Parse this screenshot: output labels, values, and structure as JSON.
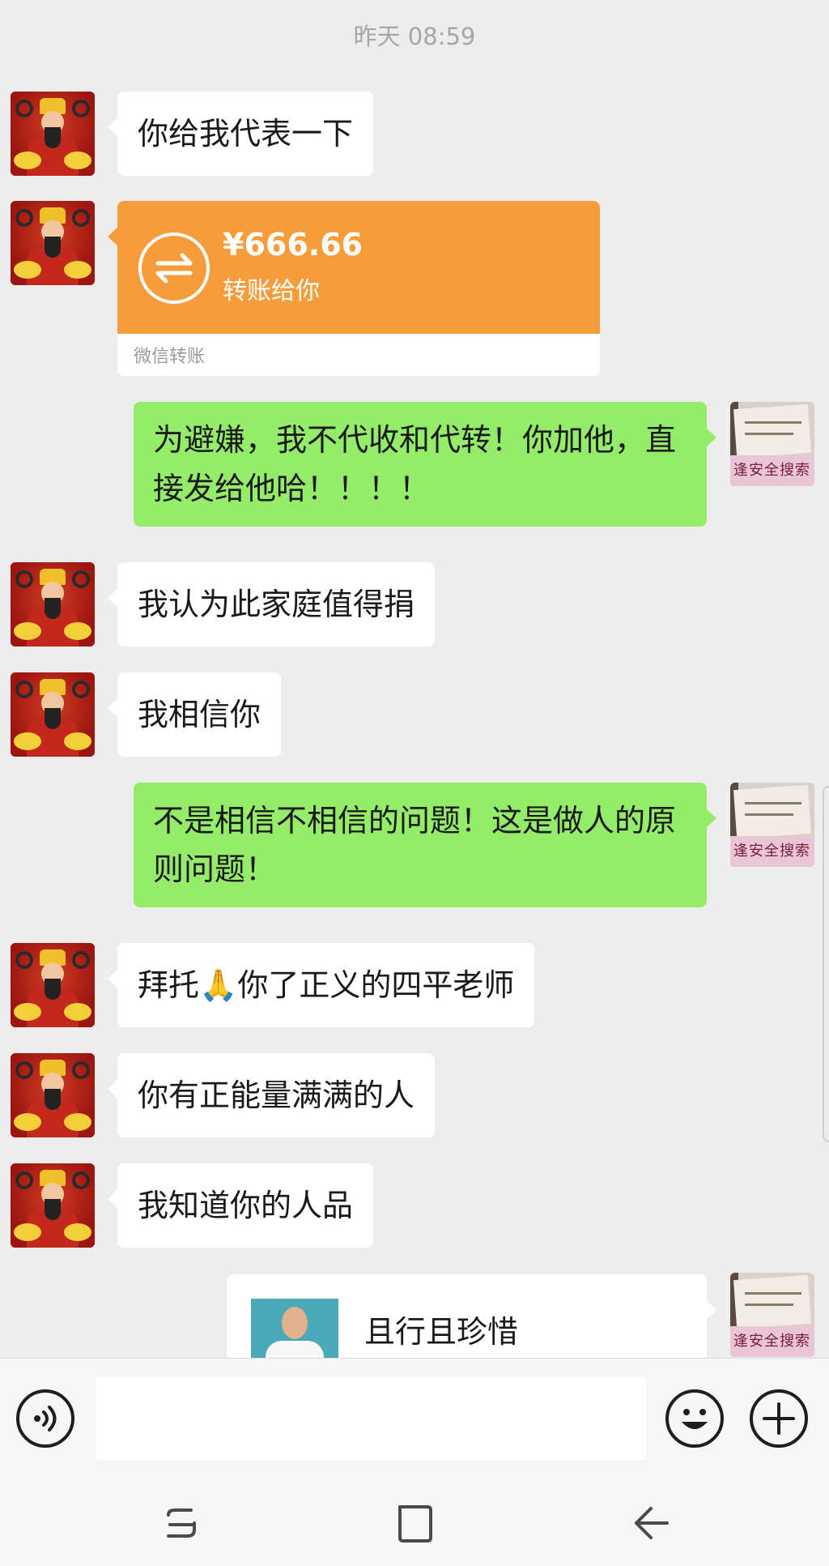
{
  "chat": {
    "timestamp": "昨天 08:59",
    "messages": [
      {
        "text": "你给我代表一下"
      },
      {
        "transfer": {
          "amount": "¥666.66",
          "subtitle": "转账给你",
          "footer": "微信转账"
        }
      },
      {
        "text": "为避嫌，我不代收和代转！你加他，直接发给他哈！！！！"
      },
      {
        "text": "我认为此家庭值得捐"
      },
      {
        "text": "我相信你"
      },
      {
        "text": "不是相信不相信的问题！这是做人的原则问题！"
      },
      {
        "text_before": "拜托",
        "emoji": "🙏",
        "text_after": "你了正义的四平老师"
      },
      {
        "text": "你有正能量满满的人"
      },
      {
        "text": "我知道你的人品"
      },
      {
        "card_title": "且行且珍惜"
      }
    ],
    "avatar_sign_text": "逢安全搜索"
  },
  "input": {
    "voice_icon": "voice-icon",
    "emoji_icon": "emoji-icon",
    "plus_icon": "plus-icon",
    "value": ""
  },
  "colors": {
    "sent_bubble": "#95ec69",
    "received_bubble": "#ffffff",
    "transfer": "#f79c3b",
    "background": "#ededed"
  }
}
